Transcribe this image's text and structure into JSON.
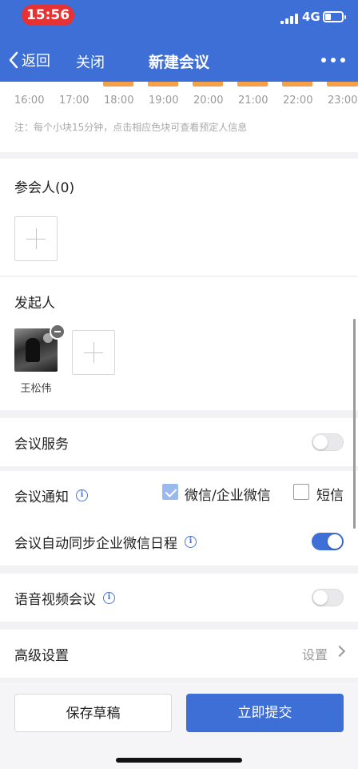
{
  "status": {
    "time": "15:56",
    "network": "4G"
  },
  "nav": {
    "back": "返回",
    "close": "关闭",
    "title": "新建会议"
  },
  "timeline": {
    "hours": [
      "16:00",
      "17:00",
      "18:00",
      "19:00",
      "20:00",
      "21:00",
      "22:00",
      "23:00"
    ],
    "note": "注：每个小块15分钟，点击相应色块可查看预定人信息",
    "block_color": "#f5a14a"
  },
  "participants": {
    "title": "参会人(0)"
  },
  "initiator": {
    "title": "发起人",
    "name": "王松伟"
  },
  "services": {
    "label": "会议服务",
    "enabled": false
  },
  "notify": {
    "label": "会议通知",
    "wechat_label": "微信/企业微信",
    "wechat_checked": true,
    "sms_label": "短信",
    "sms_checked": false
  },
  "sync": {
    "label": "会议自动同步企业微信日程",
    "enabled": true
  },
  "av": {
    "label": "语音视频会议",
    "enabled": false
  },
  "advanced": {
    "label": "高级设置",
    "value": "设置"
  },
  "actions": {
    "draft": "保存草稿",
    "submit": "立即提交"
  },
  "colors": {
    "accent": "#3e6fd6",
    "badge": "#e63232"
  }
}
